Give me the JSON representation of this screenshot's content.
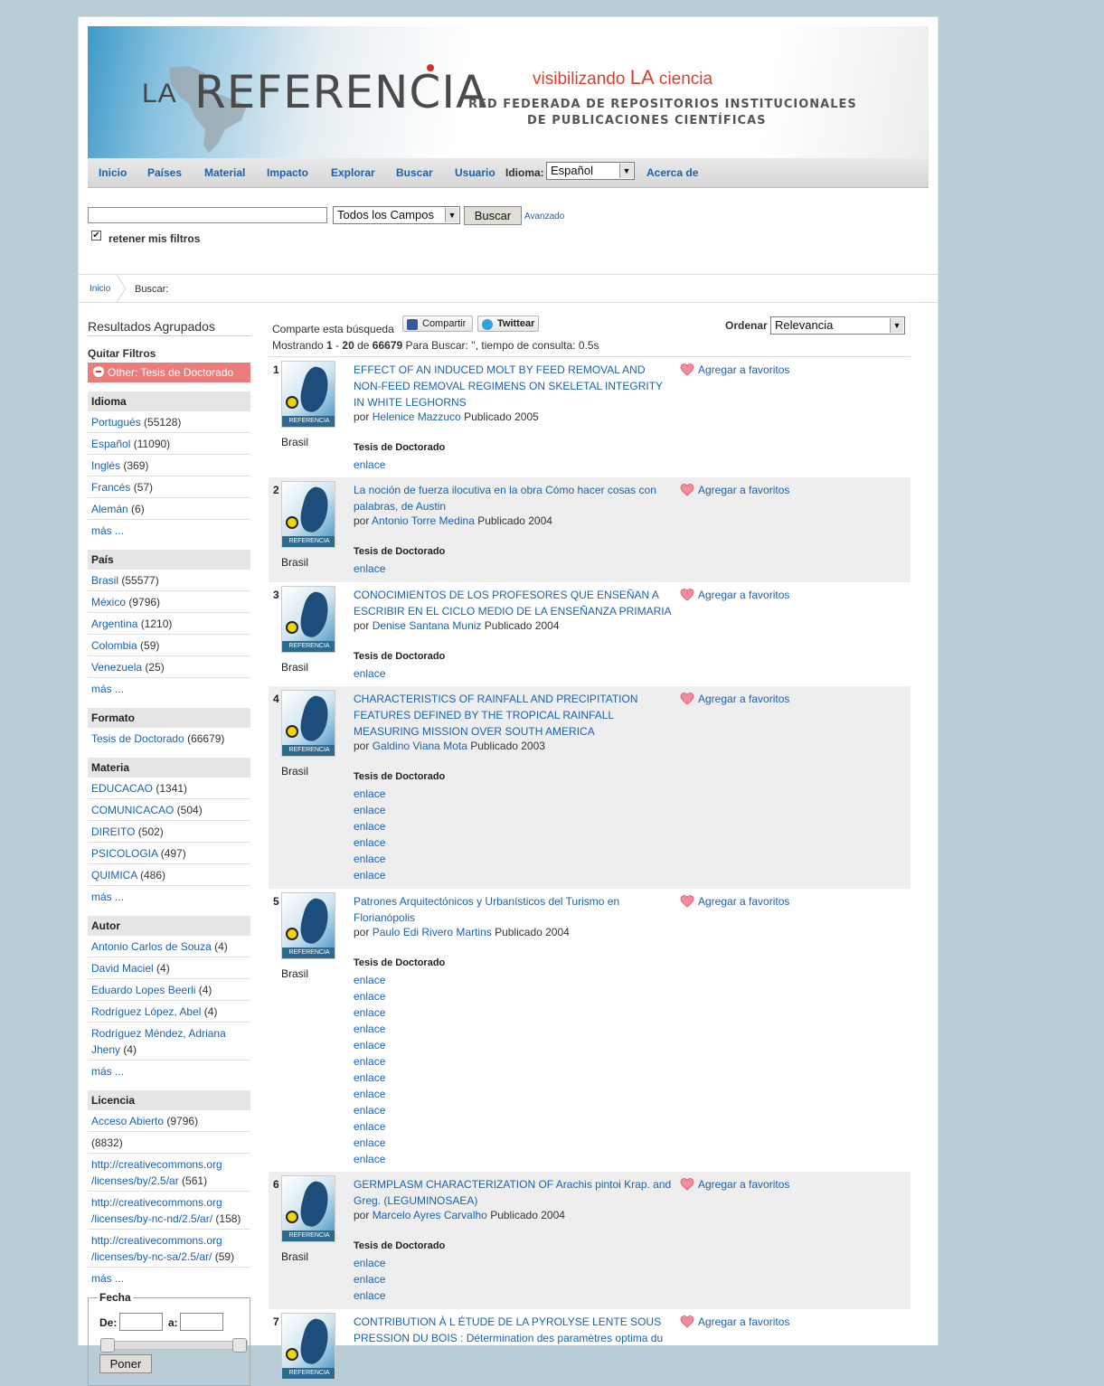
{
  "header": {
    "logo_la": "LA",
    "logo_name": "REFERENCIA",
    "tagline_1": "visibilizando ",
    "tagline_la": "LA",
    "tagline_2": " ciencia",
    "network_line1": "RED FEDERADA DE REPOSITORIOS INSTITUCIONALES",
    "network_line2": "DE PUBLICACIONES CIENTÍFICAS"
  },
  "nav": {
    "items": [
      "Inicio",
      "Países",
      "Material",
      "Impacto",
      "Explorar",
      "Buscar",
      "Usuario"
    ],
    "language_label": "Idioma:",
    "language_value": "Español",
    "about": "Acerca de"
  },
  "search": {
    "query": "",
    "field_select": "Todos los Campos",
    "button": "Buscar",
    "advanced": "Avanzado",
    "retain_label": "retener mis filtros",
    "retain_checked": true
  },
  "breadcrumb": {
    "home": "Inicio",
    "current": "Buscar:"
  },
  "sidebar": {
    "title": "Resultados Agrupados",
    "remove_filters_label": "Quitar Filtros",
    "active_filter": "Other: Tesis de Doctorado",
    "facets": [
      {
        "name": "Idioma",
        "items": [
          [
            "Portugués",
            "(55128)"
          ],
          [
            "Español",
            "(11090)"
          ],
          [
            "Inglés",
            "(369)"
          ],
          [
            "Francés",
            "(57)"
          ],
          [
            "Alemán",
            "(6)"
          ],
          [
            "más ...",
            ""
          ]
        ]
      },
      {
        "name": "País",
        "items": [
          [
            "Brasil",
            "(55577)"
          ],
          [
            "México",
            "(9796)"
          ],
          [
            "Argentina",
            "(1210)"
          ],
          [
            "Colombia",
            "(59)"
          ],
          [
            "Venezuela",
            "(25)"
          ],
          [
            "más ...",
            ""
          ]
        ]
      },
      {
        "name": "Formato",
        "items": [
          [
            "Tesis de Doctorado",
            "(66679)"
          ]
        ]
      },
      {
        "name": "Materia",
        "items": [
          [
            "EDUCACAO",
            "(1341)"
          ],
          [
            "COMUNICACAO",
            "(504)"
          ],
          [
            "DIREITO",
            "(502)"
          ],
          [
            "PSICOLOGIA",
            "(497)"
          ],
          [
            "QUIMICA",
            "(486)"
          ],
          [
            "más ...",
            ""
          ]
        ]
      },
      {
        "name": "Autor",
        "items": [
          [
            "Antonio Carlos de Souza",
            "(4)"
          ],
          [
            "David Maciel",
            "(4)"
          ],
          [
            "Eduardo Lopes Beerli",
            "(4)"
          ],
          [
            "Rodríguez López, Abel",
            "(4)"
          ],
          [
            "Rodríguez Méndez, Adriana Jheny",
            "(4)"
          ],
          [
            "más ...",
            ""
          ]
        ]
      },
      {
        "name": "Licencia",
        "items": [
          [
            "Acceso Abierto",
            "(9796)"
          ],
          [
            "",
            "(8832)"
          ],
          [
            "http://creativecommons.org /licenses/by/2.5/ar",
            "(561)"
          ],
          [
            "http://creativecommons.org /licenses/by-nc-nd/2.5/ar/",
            "(158)"
          ],
          [
            "http://creativecommons.org /licenses/by-nc-sa/2.5/ar/",
            "(59)"
          ],
          [
            "más ...",
            ""
          ]
        ]
      }
    ],
    "date": {
      "legend": "Fecha",
      "from_label": "De:",
      "to_label": "a:",
      "from_value": "",
      "to_value": "",
      "button": "Poner"
    }
  },
  "main": {
    "share_label": "Comparte esta búsqueda",
    "share_facebook": "Compartir",
    "share_twitter": "Twittear",
    "sort_label": "Ordenar",
    "sort_value": "Relevancia",
    "showing_prefix": "Mostrando ",
    "range_start": "1",
    "range_sep": " - ",
    "range_end": "20",
    "of": " de ",
    "total": "66679",
    "showing_suffix": " Para Buscar: '', tiempo de consulta: 0.5s",
    "by_label": "por ",
    "published_label": " Publicado ",
    "favorite_label": "Agregar a favoritos",
    "link_label": "enlace",
    "results": [
      {
        "n": "1",
        "country": "Brasil",
        "title": "EFFECT OF AN INDUCED MOLT BY FEED REMOVAL AND NON-FEED REMOVAL REGIMENS ON SKELETAL INTEGRITY IN WHITE LEGHORNS",
        "author": "Helenice Mazzuco",
        "year": "2005",
        "format": "Tesis de Doctorado",
        "links": 1
      },
      {
        "n": "2",
        "country": "Brasil",
        "title": "La noción de fuerza ilocutiva en la obra Cómo hacer cosas con palabras, de Austin",
        "author": "Antonio Torre Medina",
        "year": "2004",
        "format": "Tesis de Doctorado",
        "links": 1
      },
      {
        "n": "3",
        "country": "Brasil",
        "title": "CONOCIMIENTOS DE LOS PROFESORES QUE ENSEÑAN A ESCRIBIR EN EL CICLO MEDIO DE LA ENSEÑANZA PRIMARIA",
        "author": "Denise Santana Muniz",
        "year": "2004",
        "format": "Tesis de Doctorado",
        "links": 1
      },
      {
        "n": "4",
        "country": "Brasil",
        "title": "CHARACTERISTICS OF RAINFALL AND PRECIPITATION FEATURES DEFINED BY THE TROPICAL RAINFALL MEASURING MISSION OVER SOUTH AMERICA",
        "author": "Galdino Viana Mota",
        "year": "2003",
        "format": "Tesis de Doctorado",
        "links": 6
      },
      {
        "n": "5",
        "country": "Brasil",
        "title": "Patrones Arquitectónicos y Urbanísticos del Turismo en Florianópolis",
        "author": "Paulo Edi Rivero Martins",
        "year": "2004",
        "format": "Tesis de Doctorado",
        "links": 12
      },
      {
        "n": "6",
        "country": "Brasil",
        "title": "GERMPLASM CHARACTERIZATION OF Arachis pintoi Krap. and Greg. (LEGUMINOSAEA)",
        "author": "Marcelo Ayres Carvalho",
        "year": "2004",
        "format": "Tesis de Doctorado",
        "links": 3
      },
      {
        "n": "7",
        "country": "",
        "title": "CONTRIBUTION À L ÉTUDE DE LA PYROLYSE LENTE SOUS PRESSION DU BOIS : Détermination des paramètres optima du",
        "author": "",
        "year": "",
        "format": "",
        "links": 0
      }
    ]
  }
}
